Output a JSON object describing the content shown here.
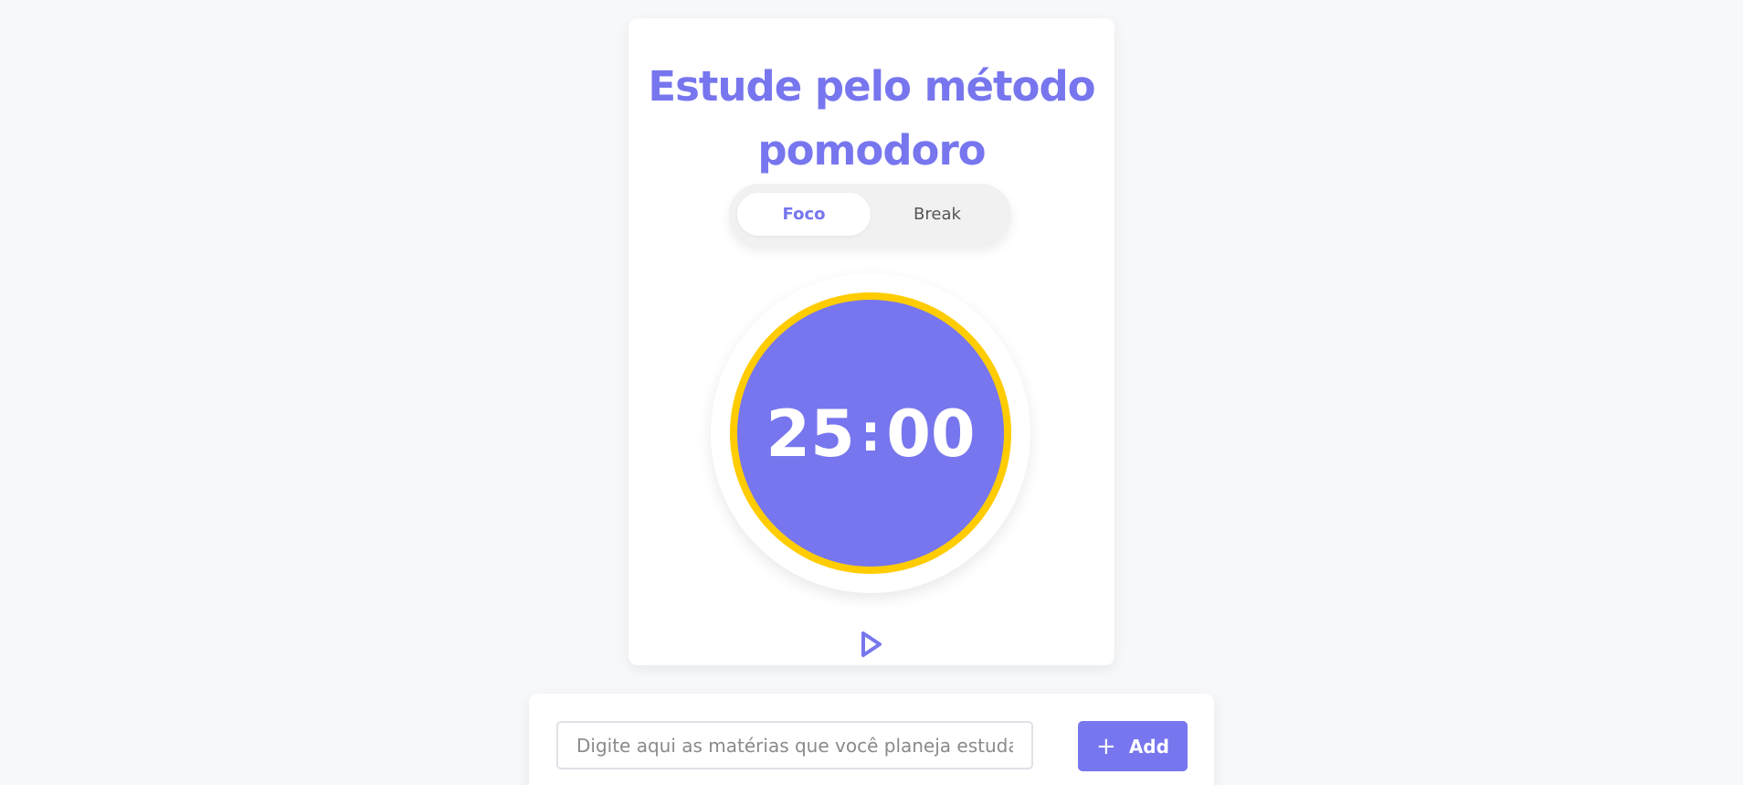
{
  "pomodoro": {
    "title": "Estude pelo método pomodoro",
    "modes": {
      "focus_label": "Foco",
      "break_label": "Break"
    },
    "timer": {
      "minutes": "25",
      "separator": ":",
      "seconds": "00"
    },
    "play_icon": "play-icon"
  },
  "tasks": {
    "input_placeholder": "Digite aqui as matérias que você planeja estudar hoje",
    "add_label": "Add",
    "add_icon": "plus-icon"
  },
  "colors": {
    "accent": "#7776ee",
    "ring": "#ffcc00",
    "background": "#f7f8fa"
  }
}
